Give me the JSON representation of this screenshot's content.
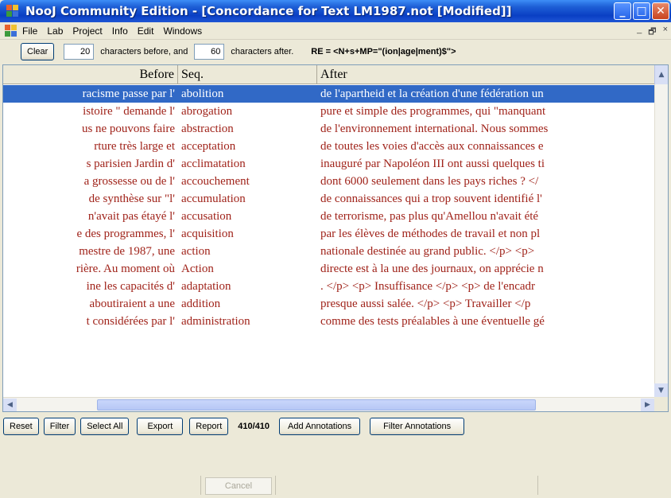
{
  "window": {
    "title": "NooJ Community Edition - [Concordance for Text LM1987.not [Modified]]",
    "controls": {
      "minimize": "_",
      "maximize": "□",
      "close": "✕"
    }
  },
  "menu": {
    "items": [
      "File",
      "Lab",
      "Project",
      "Info",
      "Edit",
      "Windows"
    ],
    "mdi_controls": [
      "_",
      "🗗",
      "×"
    ]
  },
  "toolbar": {
    "clear_label": "Clear",
    "chars_before": "20",
    "chars_before_label": "characters before, and",
    "chars_after": "60",
    "chars_after_label": "characters after.",
    "regex": "RE = <N+s+MP=\"(ion|age|ment)$\">"
  },
  "table": {
    "headers": {
      "before": "Before",
      "seq": "Seq.",
      "after": "After"
    },
    "selected_row": 0,
    "rows": [
      {
        "before": "racisme passe par l'",
        "seq": "abolition",
        "after": "de l'apartheid et la création d'une fédération un"
      },
      {
        "before": "istoire \" demande l'",
        "seq": "abrogation",
        "after": "pure et simple des programmes, qui \"manquant"
      },
      {
        "before": "us ne pouvons faire",
        "seq": "abstraction",
        "after": "de l'environnement international. Nous sommes"
      },
      {
        "before": "rture très large et",
        "seq": "acceptation",
        "after": "de toutes les voies d'accès aux connaissances e"
      },
      {
        "before": "s parisien Jardin d'",
        "seq": "acclimatation",
        "after": "inauguré par Napoléon III ont aussi quelques ti"
      },
      {
        "before": "a grossesse ou de l'",
        "seq": "accouchement",
        "after": "dont 6000 seulement dans les pays riches ? </"
      },
      {
        "before": "de synthèse sur \"l'",
        "seq": "accumulation",
        "after": "de connaissances qui a trop souvent identifié l'"
      },
      {
        "before": "n'avait pas étayé l'",
        "seq": "accusation",
        "after": "de terrorisme, pas plus qu'Amellou n'avait été"
      },
      {
        "before": "e des programmes, l'",
        "seq": "acquisition",
        "after": "par les élèves de méthodes de travail et non pl"
      },
      {
        "before": "mestre de 1987, une",
        "seq": "action",
        "after": "nationale destinée au grand public. </p> <p>"
      },
      {
        "before": "rière. Au moment où",
        "seq": "Action",
        "after": "directe est à la une des journaux, on apprécie n"
      },
      {
        "before": "ine les capacités d'",
        "seq": "adaptation",
        "after": ". </p> <p> Insuffisance </p> <p> de l'encadr"
      },
      {
        "before": "aboutiraient a une",
        "seq": "addition",
        "after": "presque aussi salée. </p> <p> Travailler </p"
      },
      {
        "before": "t considérées par l'",
        "seq": "administration",
        "after": "comme des tests préalables à une éventuelle gé"
      }
    ]
  },
  "bottom": {
    "reset_label": "Reset",
    "filter_label": "Filter",
    "select_all_label": "Select All",
    "export_label": "Export",
    "report_label": "Report",
    "count": "410/410",
    "add_annotations_label": "Add Annotations",
    "filter_annotations_label": "Filter Annotations"
  },
  "status": {
    "cancel_label": "Cancel"
  },
  "colors": {
    "selection": "#3169c6",
    "concordance_text": "#a0231a",
    "titlebar": "#0a3fc4"
  }
}
